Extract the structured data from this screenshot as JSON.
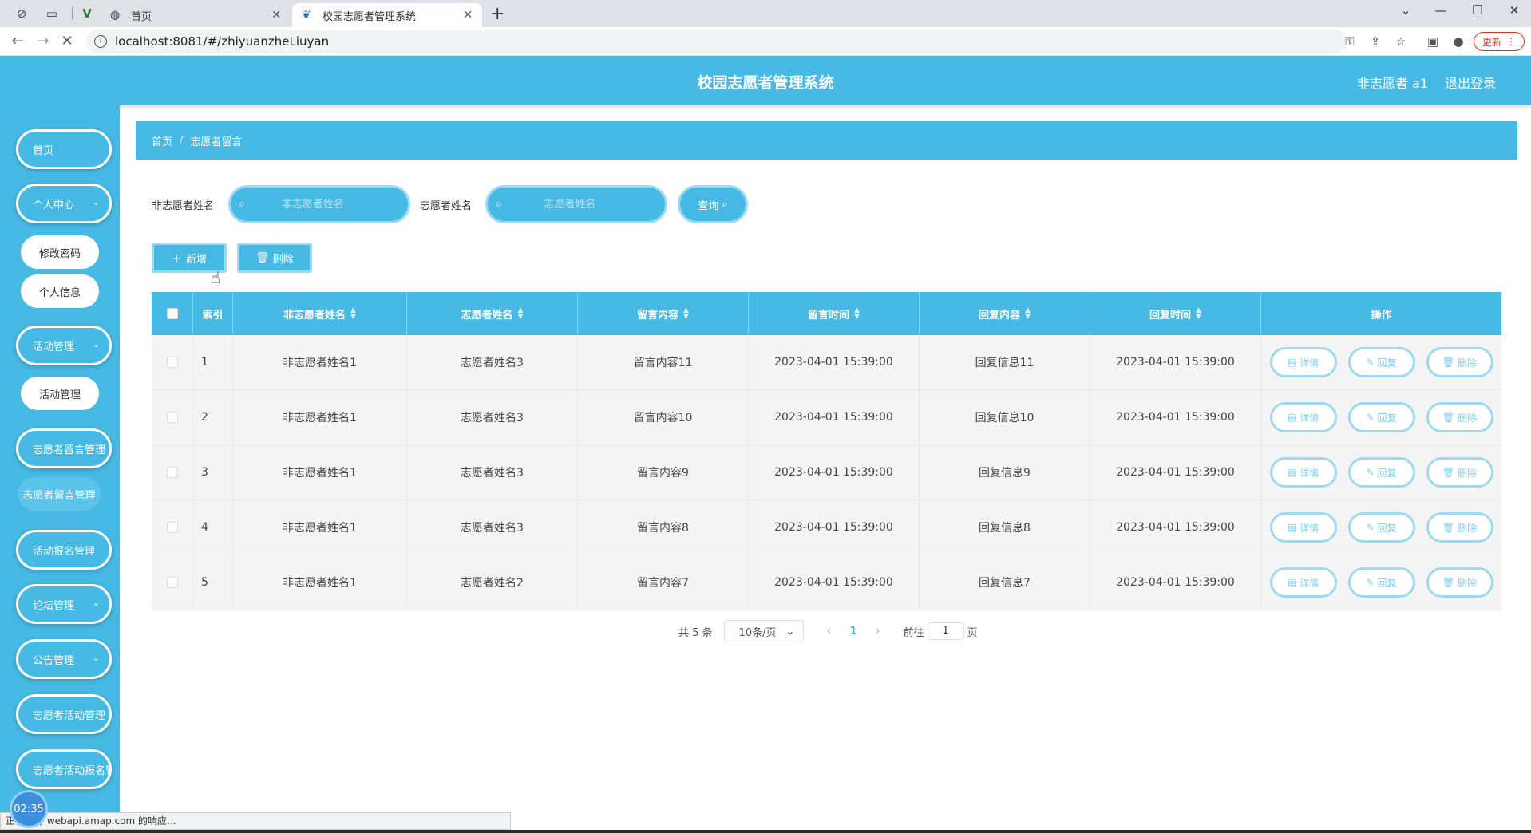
{
  "browser": {
    "tabs": [
      {
        "title": "首页",
        "active": false
      },
      {
        "title": "校园志愿者管理系统",
        "active": true
      }
    ],
    "url": "localhost:8081/#/zhiyuanzheLiuyan",
    "update_label": "更新",
    "status_text": "正在等待 webapi.amap.com 的响应...",
    "timer": "02:35"
  },
  "header": {
    "title": "校园志愿者管理系统",
    "user": "非志愿者 a1",
    "logout": "退出登录"
  },
  "sidebar": {
    "items": [
      {
        "label": "首页"
      },
      {
        "label": "个人中心",
        "expandable": true
      },
      {
        "label": "修改密码",
        "sub": true
      },
      {
        "label": "个人信息",
        "sub": true
      },
      {
        "label": "活动管理",
        "expandable": true
      },
      {
        "label": "活动管理",
        "sub": true
      },
      {
        "label": "志愿者留言管理",
        "expandable": true
      },
      {
        "label": "志愿者留言管理",
        "sub": true,
        "selected": true
      },
      {
        "label": "活动报名管理",
        "expandable": true
      },
      {
        "label": "论坛管理",
        "expandable": true
      },
      {
        "label": "公告管理",
        "expandable": true
      },
      {
        "label": "志愿者活动管理",
        "expandable": true
      },
      {
        "label": "志愿者活动报名管理",
        "expandable": true
      }
    ]
  },
  "breadcrumb": {
    "home": "首页",
    "separator": "/",
    "current": "志愿者留言"
  },
  "search": {
    "label1": "非志愿者姓名",
    "placeholder1": "非志愿者姓名",
    "label2": "志愿者姓名",
    "placeholder2": "志愿者姓名",
    "query": "查询"
  },
  "actions": {
    "add": "新增",
    "delete": "删除"
  },
  "table": {
    "columns": [
      "索引",
      "非志愿者姓名",
      "志愿者姓名",
      "留言内容",
      "留言时间",
      "回复内容",
      "回复时间",
      "操作"
    ],
    "rows": [
      {
        "index": "1",
        "nonvol": "非志愿者姓名1",
        "vol": "志愿者姓名3",
        "content": "留言内容11",
        "time": "2023-04-01 15:39:00",
        "reply": "回复信息11",
        "reply_time": "2023-04-01 15:39:00"
      },
      {
        "index": "2",
        "nonvol": "非志愿者姓名1",
        "vol": "志愿者姓名3",
        "content": "留言内容10",
        "time": "2023-04-01 15:39:00",
        "reply": "回复信息10",
        "reply_time": "2023-04-01 15:39:00"
      },
      {
        "index": "3",
        "nonvol": "非志愿者姓名1",
        "vol": "志愿者姓名3",
        "content": "留言内容9",
        "time": "2023-04-01 15:39:00",
        "reply": "回复信息9",
        "reply_time": "2023-04-01 15:39:00"
      },
      {
        "index": "4",
        "nonvol": "非志愿者姓名1",
        "vol": "志愿者姓名3",
        "content": "留言内容8",
        "time": "2023-04-01 15:39:00",
        "reply": "回复信息8",
        "reply_time": "2023-04-01 15:39:00"
      },
      {
        "index": "5",
        "nonvol": "非志愿者姓名1",
        "vol": "志愿者姓名2",
        "content": "留言内容7",
        "time": "2023-04-01 15:39:00",
        "reply": "回复信息7",
        "reply_time": "2023-04-01 15:39:00"
      }
    ],
    "ops": {
      "detail": "详情",
      "reply": "回复",
      "delete": "删除"
    }
  },
  "pagination": {
    "total": "共 5 条",
    "page_size": "10条/页",
    "current": "1",
    "goto_prefix": "前往",
    "goto_value": "1",
    "goto_suffix": "页"
  },
  "colors": {
    "primary": "#46b9e4",
    "border_light": "#9dd9f1"
  }
}
